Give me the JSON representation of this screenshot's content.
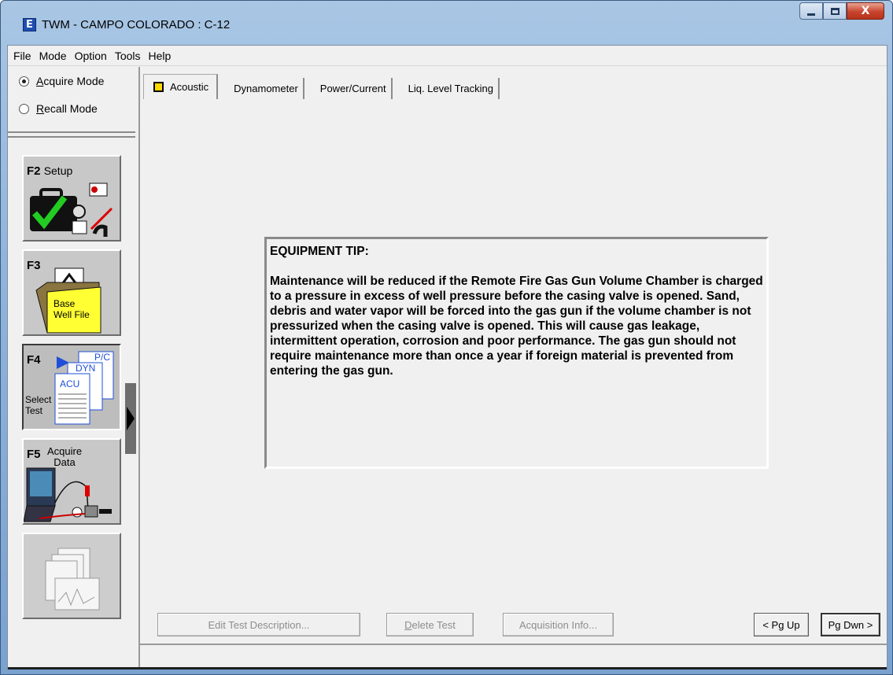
{
  "window": {
    "title": "TWM  -  CAMPO COLORADO : C-12",
    "icon_letter": "E",
    "close_glyph": "X"
  },
  "menu": [
    "File",
    "Mode",
    "Option",
    "Tools",
    "Help"
  ],
  "modes": {
    "acquire_prefix": "A",
    "acquire_rest": "cquire Mode",
    "recall_prefix": "R",
    "recall_rest": "ecall Mode",
    "selected": "acquire"
  },
  "function_buttons": {
    "f2": {
      "key": "F2",
      "label": "Setup"
    },
    "f3": {
      "key": "F3",
      "caption_line1": "Base",
      "caption_line2": "Well File"
    },
    "f4": {
      "key": "F4",
      "caption_line1": "Select",
      "caption_line2": "Test",
      "doc_labels": [
        "P/C",
        "DYN",
        "ACU"
      ]
    },
    "f5": {
      "key": "F5",
      "label_line1": "Acquire",
      "label_line2": "Data"
    }
  },
  "tabs": [
    {
      "label": "Acoustic",
      "active": true
    },
    {
      "label": "Dynamometer",
      "active": false
    },
    {
      "label": "Power/Current",
      "active": false
    },
    {
      "label": "Liq. Level Tracking",
      "active": false
    }
  ],
  "tip": {
    "heading": "EQUIPMENT TIP:",
    "body": "Maintenance will be reduced if the Remote Fire Gas Gun Volume Chamber is charged to a pressure in excess of well pressure before the casing valve is opened.  Sand, debris and water vapor will be forced into the gas gun if the volume chamber is not pressurized when the casing valve is opened. This will cause gas leakage, intermittent operation, corrosion and poor performance.  The gas gun should not require maintenance more than once a year if foreign material is prevented from entering the gas gun."
  },
  "buttons": {
    "edit_desc": "Edit Test Description...",
    "delete_prefix": "D",
    "delete_rest": "elete Test",
    "acq_info": "Acquisition Info...",
    "pg_up": "< Pg Up",
    "pg_dwn": "Pg Dwn >"
  },
  "colors": {
    "tab_indicator": "#ffd700",
    "well_file_folder": "#ffff33",
    "check": "#22cc22",
    "select_arrow": "#1f4fd8"
  }
}
